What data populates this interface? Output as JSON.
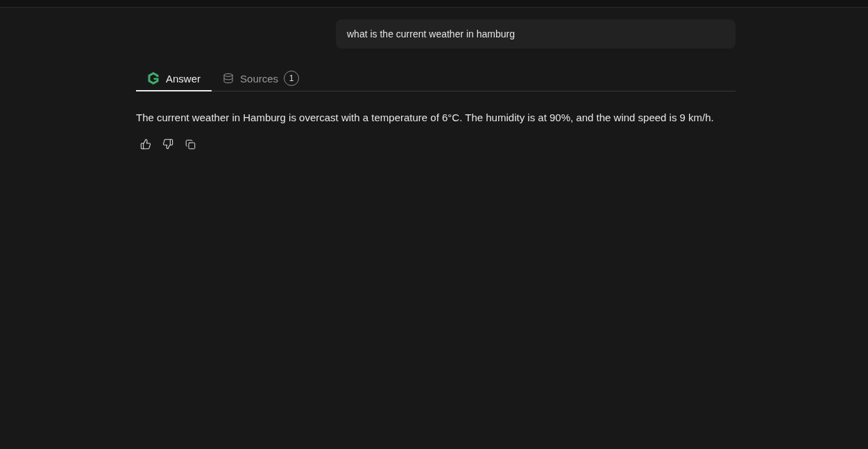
{
  "query": {
    "text": "what is the current weather in hamburg"
  },
  "tabs": [
    {
      "kind": "answer",
      "label": "Answer",
      "selected": true
    },
    {
      "kind": "sources",
      "label": "Sources",
      "count": "1",
      "selected": false
    }
  ],
  "answer": {
    "text": "The current weather in Hamburg is overcast with a temperature of 6°C. The humidity is at 90%, and the wind speed is 9 km/h."
  },
  "actions": [
    {
      "kind": "like"
    },
    {
      "kind": "dislike"
    },
    {
      "kind": "copy"
    }
  ]
}
